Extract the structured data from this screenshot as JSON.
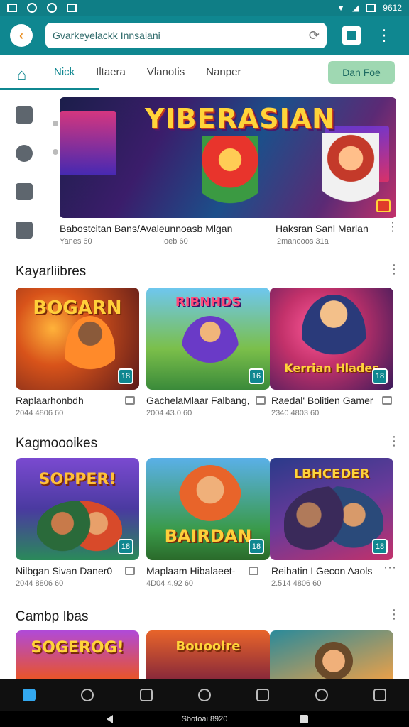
{
  "status": {
    "time": "9612"
  },
  "search": {
    "value": "Gvarkeyelackk Innsaiani"
  },
  "tabs": [
    {
      "label": "Nick",
      "active": true
    },
    {
      "label": "Iltaera",
      "active": false
    },
    {
      "label": "Vlanotis",
      "active": false
    },
    {
      "label": "Nanper",
      "active": false
    }
  ],
  "promo": {
    "label": "Dan Foe"
  },
  "hero": {
    "title": "YIBERASIAN",
    "caption_left": "Babostcitan Bans/Avaleunnoasb Mlgan",
    "sub_left": "Yanes 60",
    "sub_mid": "Ioeb 60",
    "caption_right": "Haksran Sanl Marlan",
    "sub_right": "2manooos 31a"
  },
  "sections": [
    {
      "title": "Kayarliibres",
      "cards": [
        {
          "art_title": "BOGARN",
          "caption": "Raplaarhonbdh",
          "meta": "2044 4806 60",
          "tag": "18"
        },
        {
          "art_title": "RIBNHDS",
          "caption": "GachelaMlaar Falbang,",
          "meta": "2004 43.0 60",
          "tag": "16"
        },
        {
          "art_title": "Kerrian Hlades",
          "caption": "Raedal' Bolitien Gamer",
          "meta": "2340 4803 60",
          "tag": "18"
        }
      ]
    },
    {
      "title": "Kagmoooikes",
      "cards": [
        {
          "art_title": "SOPPER!",
          "caption": "Nilbgan Sivan Daner0",
          "meta": "2044 8806 60",
          "tag": "18"
        },
        {
          "art_title": "BAIRDAN",
          "caption": "Maplaam Hibalaeet-",
          "meta": "4D04 4.92 60",
          "tag": "18"
        },
        {
          "art_title": "LBHCEDER",
          "caption": "Reihatin I Gecon Aaols",
          "meta": "2.514 4806 60",
          "tag": "18"
        }
      ]
    },
    {
      "title": "Cambp Ibas",
      "cards": [
        {
          "art_title": "SOGEROG!",
          "tag": ""
        },
        {
          "art_title": "Bouooire",
          "tag": ""
        },
        {
          "art_title": "",
          "tag": ""
        }
      ]
    }
  ],
  "sysbar": {
    "label": "Sbotoai 8920"
  }
}
